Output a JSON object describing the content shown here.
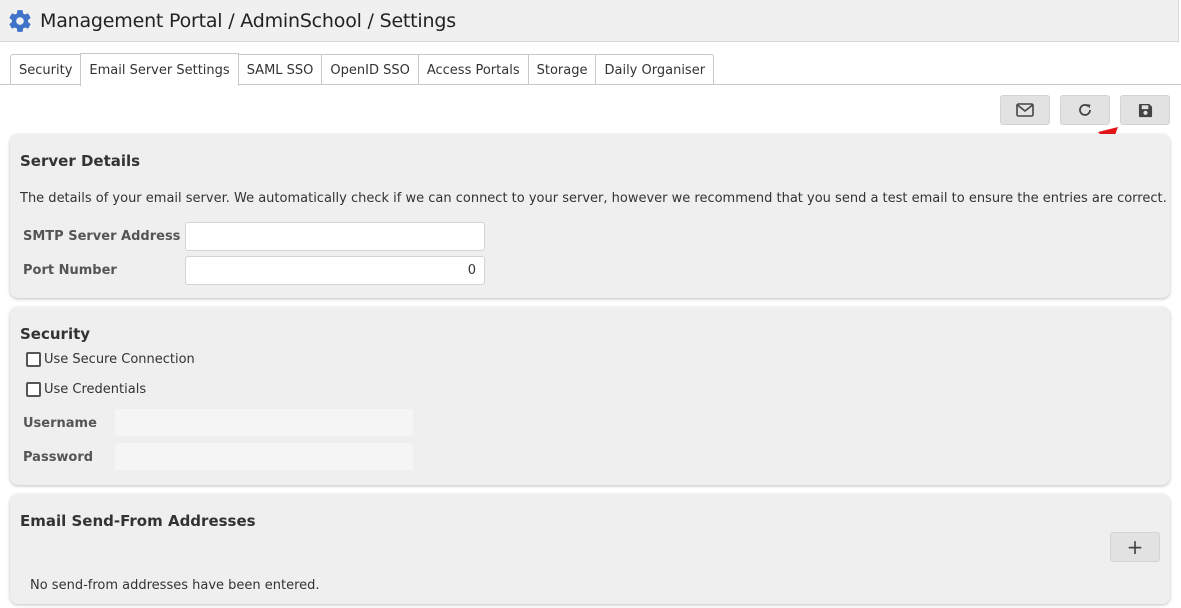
{
  "header": {
    "title": "Management Portal / AdminSchool / Settings",
    "icon": "gear-icon"
  },
  "tabs": [
    {
      "label": "Security",
      "active": false
    },
    {
      "label": "Email Server Settings",
      "active": true
    },
    {
      "label": "SAML SSO",
      "active": false
    },
    {
      "label": "OpenID SSO",
      "active": false
    },
    {
      "label": "Access Portals",
      "active": false
    },
    {
      "label": "Storage",
      "active": false
    },
    {
      "label": "Daily Organiser",
      "active": false
    }
  ],
  "toolbar": {
    "send_test_email_icon": "envelope-icon",
    "refresh_icon": "refresh-icon",
    "save_icon": "save-icon"
  },
  "server_details": {
    "heading": "Server Details",
    "description": "The details of your email server. We automatically check if we can connect to your server, however we recommend that you send a test email to ensure the entries are correct.",
    "smtp_label": "SMTP Server Address",
    "smtp_value": "",
    "port_label": "Port Number",
    "port_value": "0"
  },
  "security": {
    "heading": "Security",
    "secure_connection_label": "Use Secure Connection",
    "secure_connection_checked": false,
    "credentials_label": "Use Credentials",
    "credentials_checked": false,
    "username_label": "Username",
    "username_value": "",
    "password_label": "Password",
    "password_value": ""
  },
  "send_from": {
    "heading": "Email Send-From Addresses",
    "add_label": "+",
    "empty_message": "No send-from addresses have been entered."
  },
  "colors": {
    "accent": "#3f73c8",
    "annotation_arrow": "#e3171b",
    "panel_bg": "#efefef",
    "button_bg": "#e2e2e2"
  }
}
